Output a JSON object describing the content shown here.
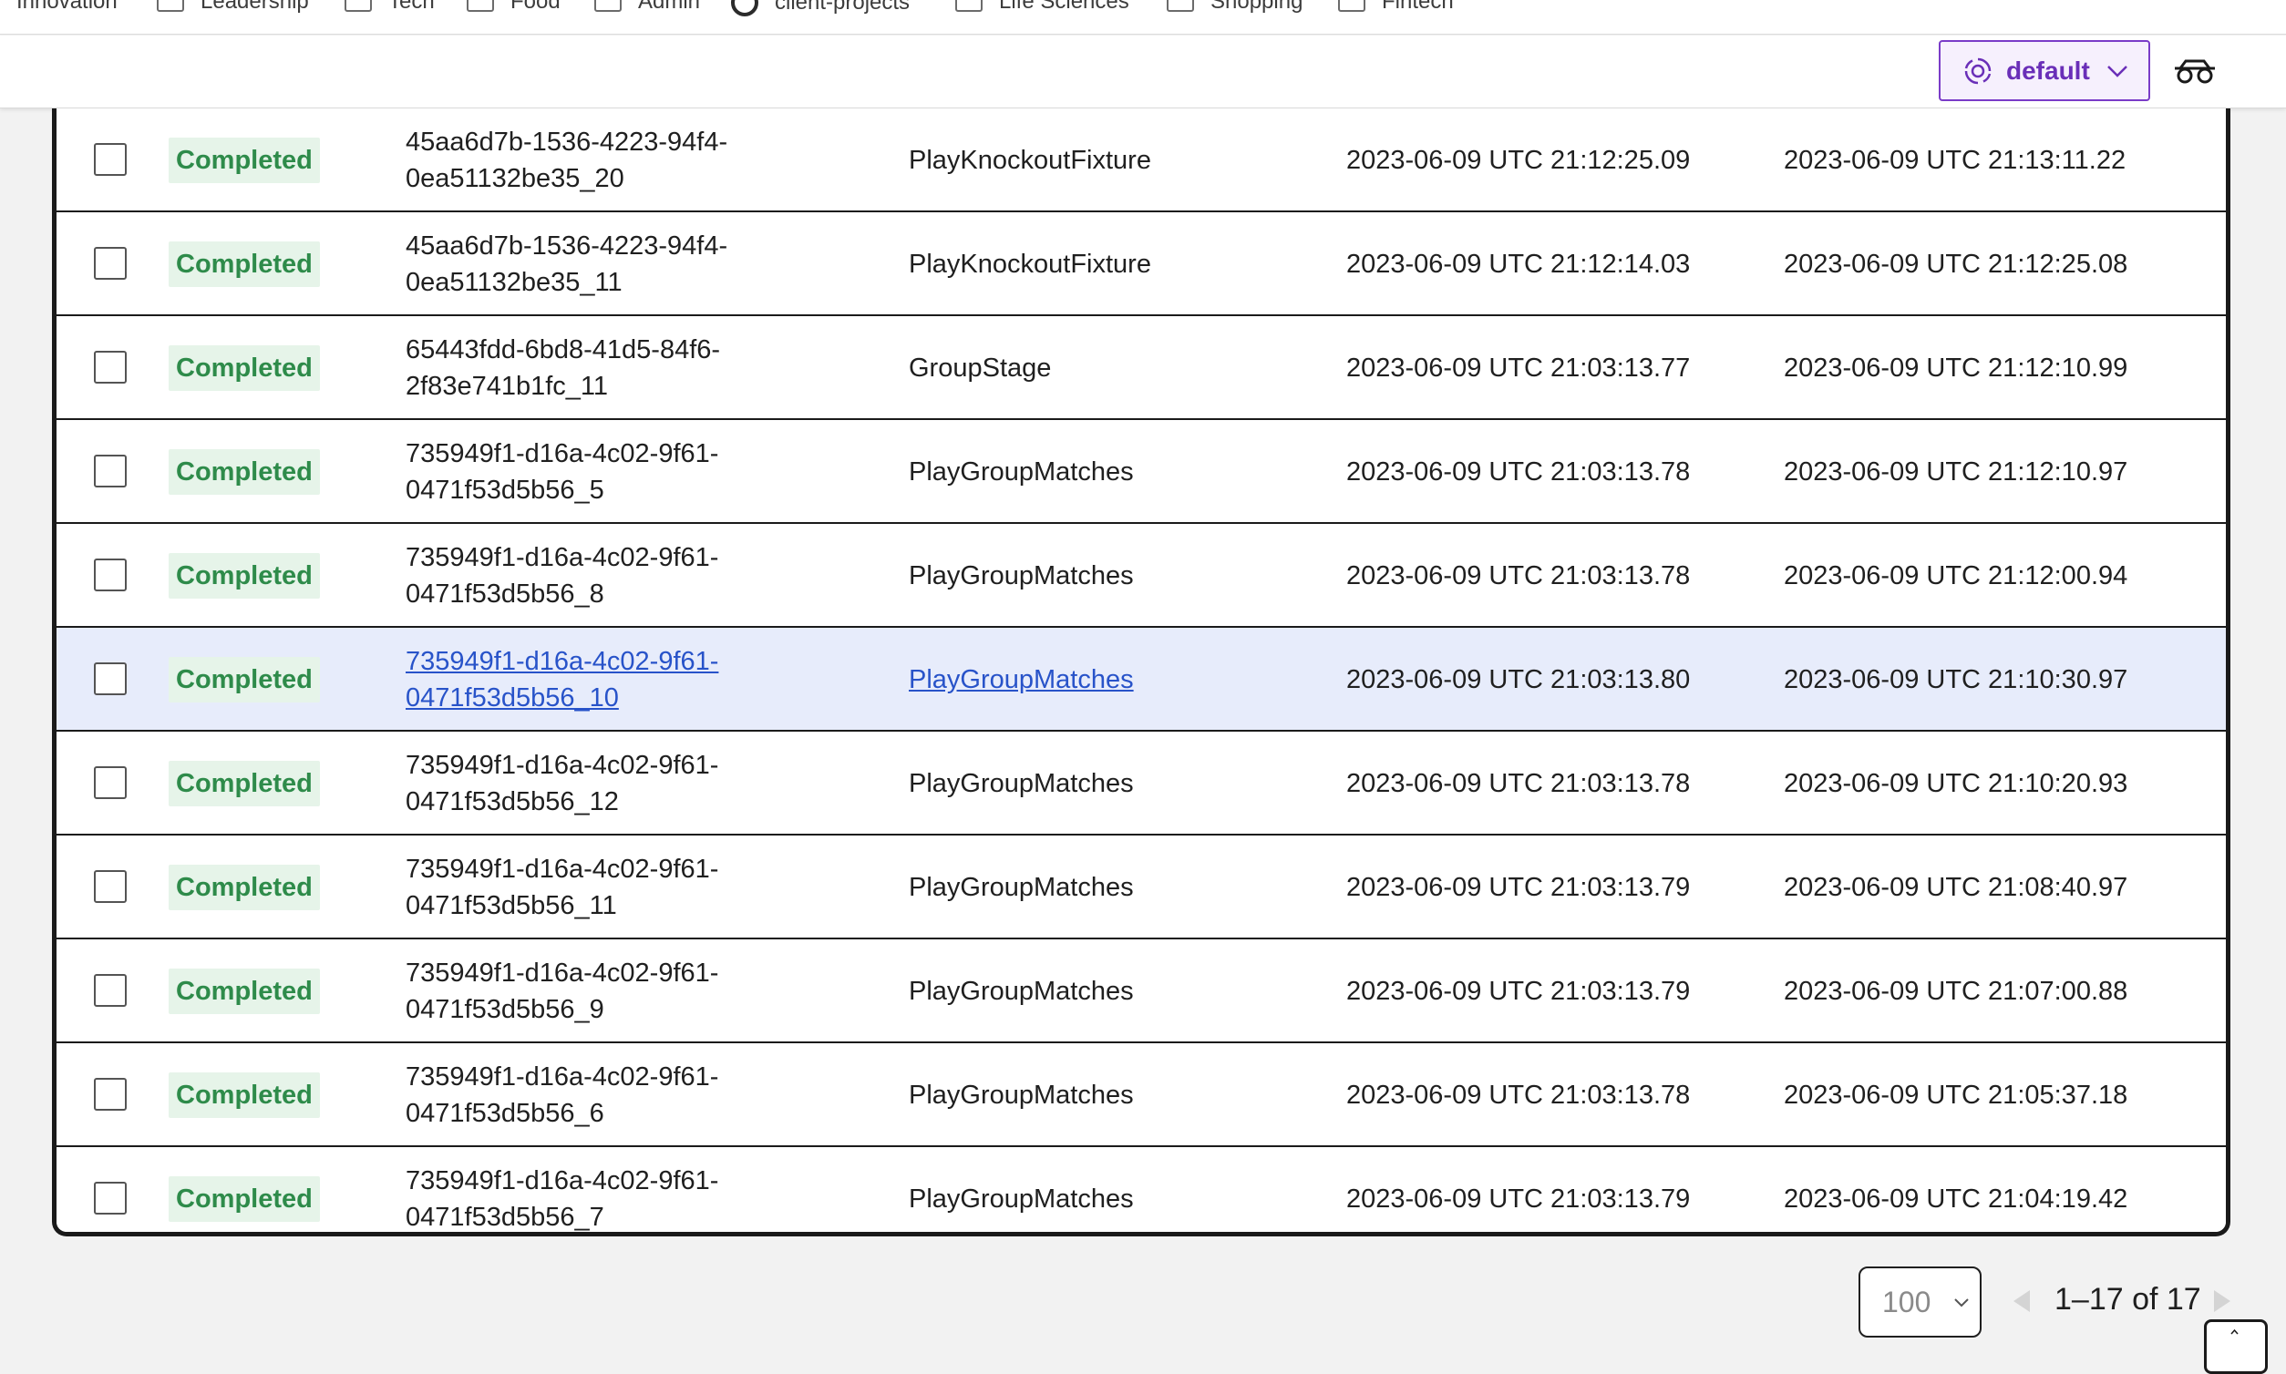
{
  "bookmarks": [
    {
      "label": "Innovation",
      "icon": "folder-icon"
    },
    {
      "label": "Leadership",
      "icon": "folder-icon"
    },
    {
      "label": "Tech",
      "icon": "folder-icon"
    },
    {
      "label": "Food",
      "icon": "folder-icon"
    },
    {
      "label": "Admin",
      "icon": "folder-icon"
    },
    {
      "label": "client-projects",
      "icon": "github-icon"
    },
    {
      "label": "Life Sciences",
      "icon": "folder-icon"
    },
    {
      "label": "Shopping",
      "icon": "folder-icon"
    },
    {
      "label": "Fintech",
      "icon": "folder-icon"
    }
  ],
  "header": {
    "namespace_label": "default",
    "accent_color": "#7a3cc8"
  },
  "rows": [
    {
      "status": "Completed",
      "id": "45aa6d7b-1536-4223-94f4-0ea51132be35_20",
      "id_line1": "45aa6d7b-1536-4223-94f4-",
      "id_line2": "0ea51132be35_20",
      "name": "PlayKnockoutFixture",
      "start": "2023-06-09 UTC 21:12:25.09",
      "end": "2023-06-09 UTC 21:13:11.22"
    },
    {
      "status": "Completed",
      "id": "45aa6d7b-1536-4223-94f4-0ea51132be35_11",
      "id_line1": "45aa6d7b-1536-4223-94f4-",
      "id_line2": "0ea51132be35_11",
      "name": "PlayKnockoutFixture",
      "start": "2023-06-09 UTC 21:12:14.03",
      "end": "2023-06-09 UTC 21:12:25.08"
    },
    {
      "status": "Completed",
      "id": "65443fdd-6bd8-41d5-84f6-2f83e741b1fc_11",
      "id_line1": "65443fdd-6bd8-41d5-84f6-",
      "id_line2": "2f83e741b1fc_11",
      "name": "GroupStage",
      "start": "2023-06-09 UTC 21:03:13.77",
      "end": "2023-06-09 UTC 21:12:10.99"
    },
    {
      "status": "Completed",
      "id": "735949f1-d16a-4c02-9f61-0471f53d5b56_5",
      "id_line1": "735949f1-d16a-4c02-9f61-",
      "id_line2": "0471f53d5b56_5",
      "name": "PlayGroupMatches",
      "start": "2023-06-09 UTC 21:03:13.78",
      "end": "2023-06-09 UTC 21:12:10.97"
    },
    {
      "status": "Completed",
      "id": "735949f1-d16a-4c02-9f61-0471f53d5b56_8",
      "id_line1": "735949f1-d16a-4c02-9f61-",
      "id_line2": "0471f53d5b56_8",
      "name": "PlayGroupMatches",
      "start": "2023-06-09 UTC 21:03:13.78",
      "end": "2023-06-09 UTC 21:12:00.94"
    },
    {
      "status": "Completed",
      "id": "735949f1-d16a-4c02-9f61-0471f53d5b56_10",
      "id_line1": "735949f1-d16a-4c02-9f61-",
      "id_line2": "0471f53d5b56_10",
      "name": "PlayGroupMatches",
      "start": "2023-06-09 UTC 21:03:13.80",
      "end": "2023-06-09 UTC 21:10:30.97",
      "highlighted": true
    },
    {
      "status": "Completed",
      "id": "735949f1-d16a-4c02-9f61-0471f53d5b56_12",
      "id_line1": "735949f1-d16a-4c02-9f61-",
      "id_line2": "0471f53d5b56_12",
      "name": "PlayGroupMatches",
      "start": "2023-06-09 UTC 21:03:13.78",
      "end": "2023-06-09 UTC 21:10:20.93"
    },
    {
      "status": "Completed",
      "id": "735949f1-d16a-4c02-9f61-0471f53d5b56_11",
      "id_line1": "735949f1-d16a-4c02-9f61-",
      "id_line2": "0471f53d5b56_11",
      "name": "PlayGroupMatches",
      "start": "2023-06-09 UTC 21:03:13.79",
      "end": "2023-06-09 UTC 21:08:40.97"
    },
    {
      "status": "Completed",
      "id": "735949f1-d16a-4c02-9f61-0471f53d5b56_9",
      "id_line1": "735949f1-d16a-4c02-9f61-",
      "id_line2": "0471f53d5b56_9",
      "name": "PlayGroupMatches",
      "start": "2023-06-09 UTC 21:03:13.79",
      "end": "2023-06-09 UTC 21:07:00.88"
    },
    {
      "status": "Completed",
      "id": "735949f1-d16a-4c02-9f61-0471f53d5b56_6",
      "id_line1": "735949f1-d16a-4c02-9f61-",
      "id_line2": "0471f53d5b56_6",
      "name": "PlayGroupMatches",
      "start": "2023-06-09 UTC 21:03:13.78",
      "end": "2023-06-09 UTC 21:05:37.18"
    },
    {
      "status": "Completed",
      "id": "735949f1-d16a-4c02-9f61-0471f53d5b56_7",
      "id_line1": "735949f1-d16a-4c02-9f61-",
      "id_line2": "0471f53d5b56_7",
      "name": "PlayGroupMatches",
      "start": "2023-06-09 UTC 21:03:13.79",
      "end": "2023-06-09 UTC 21:04:19.42"
    }
  ],
  "pagination": {
    "per_page": "100",
    "range": "1–17 of 17"
  },
  "colors": {
    "status_completed_bg": "#e6f4e9",
    "status_completed_text": "#2e8b4a",
    "highlight_row": "#e7ecfb",
    "link": "#2853c9"
  }
}
